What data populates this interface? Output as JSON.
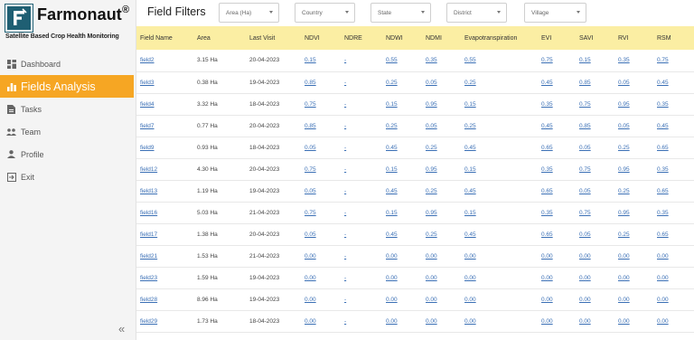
{
  "brand": {
    "name": "Farmonaut",
    "reg": "®",
    "tagline": "Satellite Based Crop Health Monitoring"
  },
  "sidebar": {
    "items": [
      {
        "label": "Dashboard",
        "icon": "dashboard-icon"
      },
      {
        "label": "Fields Analysis",
        "icon": "bar-chart-icon",
        "active": true
      },
      {
        "label": "Tasks",
        "icon": "document-icon"
      },
      {
        "label": "Team",
        "icon": "team-icon"
      },
      {
        "label": "Profile",
        "icon": "person-icon"
      },
      {
        "label": "Exit",
        "icon": "exit-icon"
      }
    ],
    "collapse_label": "«"
  },
  "filters": {
    "title": "Field Filters",
    "selects": [
      {
        "label": "Area (Ha)"
      },
      {
        "label": "Country"
      },
      {
        "label": "State"
      },
      {
        "label": "District"
      },
      {
        "label": "Village"
      }
    ]
  },
  "colors": {
    "accent": "#f6a623",
    "header_bg": "#fbeea3",
    "link": "#3a6fb5",
    "logo": "#1f5f73"
  },
  "table": {
    "columns": [
      "Field Name",
      "Area",
      "Last Visit",
      "NDVI",
      "NDRE",
      "NDWI",
      "NDMI",
      "Evapotranspiration",
      "EVI",
      "SAVI",
      "RVI",
      "RSM"
    ],
    "rows": [
      [
        "field2",
        "3.15 Ha",
        "20-04-2023",
        "0.15",
        "-",
        "0.55",
        "0.35",
        "0.55",
        "0.75",
        "0.15",
        "0.35",
        "0.75"
      ],
      [
        "field3",
        "0.38 Ha",
        "19-04-2023",
        "0.85",
        "-",
        "0.25",
        "0.05",
        "0.25",
        "0.45",
        "0.85",
        "0.05",
        "0.45"
      ],
      [
        "field4",
        "3.32 Ha",
        "18-04-2023",
        "0.75",
        "-",
        "0.15",
        "0.95",
        "0.15",
        "0.35",
        "0.75",
        "0.95",
        "0.35"
      ],
      [
        "field7",
        "0.77 Ha",
        "20-04-2023",
        "0.85",
        "-",
        "0.25",
        "0.05",
        "0.25",
        "0.45",
        "0.85",
        "0.05",
        "0.45"
      ],
      [
        "field9",
        "0.93 Ha",
        "18-04-2023",
        "0.05",
        "-",
        "0.45",
        "0.25",
        "0.45",
        "0.65",
        "0.05",
        "0.25",
        "0.65"
      ],
      [
        "field12",
        "4.30 Ha",
        "20-04-2023",
        "0.75",
        "-",
        "0.15",
        "0.95",
        "0.15",
        "0.35",
        "0.75",
        "0.95",
        "0.35"
      ],
      [
        "field13",
        "1.19 Ha",
        "19-04-2023",
        "0.05",
        "-",
        "0.45",
        "0.25",
        "0.45",
        "0.65",
        "0.05",
        "0.25",
        "0.65"
      ],
      [
        "field16",
        "5.03 Ha",
        "21-04-2023",
        "0.75",
        "-",
        "0.15",
        "0.95",
        "0.15",
        "0.35",
        "0.75",
        "0.95",
        "0.35"
      ],
      [
        "field17",
        "1.38 Ha",
        "20-04-2023",
        "0.05",
        "-",
        "0.45",
        "0.25",
        "0.45",
        "0.65",
        "0.05",
        "0.25",
        "0.65"
      ],
      [
        "field21",
        "1.53 Ha",
        "21-04-2023",
        "0.00",
        "-",
        "0.00",
        "0.00",
        "0.00",
        "0.00",
        "0.00",
        "0.00",
        "0.00"
      ],
      [
        "field23",
        "1.59 Ha",
        "19-04-2023",
        "0.00",
        "-",
        "0.00",
        "0.00",
        "0.00",
        "0.00",
        "0.00",
        "0.00",
        "0.00"
      ],
      [
        "field28",
        "8.96 Ha",
        "19-04-2023",
        "0.00",
        "-",
        "0.00",
        "0.00",
        "0.00",
        "0.00",
        "0.00",
        "0.00",
        "0.00"
      ],
      [
        "field29",
        "1.73 Ha",
        "18-04-2023",
        "0.00",
        "-",
        "0.00",
        "0.00",
        "0.00",
        "0.00",
        "0.00",
        "0.00",
        "0.00"
      ]
    ]
  }
}
